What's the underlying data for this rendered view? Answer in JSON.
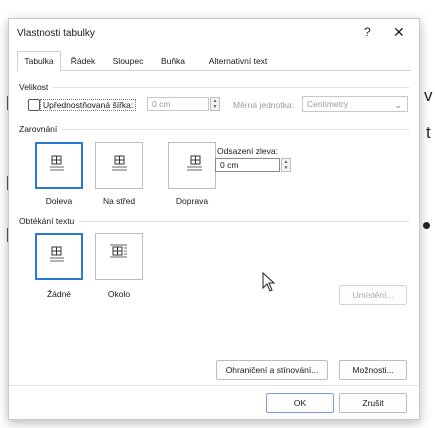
{
  "background": {
    "glyph_v": "v",
    "glyph_t": "t"
  },
  "dialog": {
    "title": "Vlastnosti tabulky",
    "help_label": "?",
    "close_label": "✕"
  },
  "tabs": [
    {
      "label": "Tabulka",
      "active": true
    },
    {
      "label": "Řádek",
      "active": false
    },
    {
      "label": "Sloupec",
      "active": false
    },
    {
      "label": "Buňka",
      "active": false
    },
    {
      "label": "Alternativní text",
      "active": false
    }
  ],
  "size": {
    "section_label": "Velikost",
    "preferred_width_label": "Upřednostňovaná šířka:",
    "preferred_width_checked": false,
    "preferred_width_value": "0 cm",
    "unit_label": "Měrná jednotka:",
    "unit_value": "Centimetry"
  },
  "alignment": {
    "section_label": "Zarovnání",
    "options": [
      {
        "label": "Doleva",
        "selected": true
      },
      {
        "label": "Na střed",
        "selected": false
      },
      {
        "label": "Doprava",
        "selected": false
      }
    ],
    "indent_label": "Odsazení zleva:",
    "indent_value": "0 cm"
  },
  "wrapping": {
    "section_label": "Obtékání textu",
    "options": [
      {
        "label": "Žádné",
        "selected": true
      },
      {
        "label": "Okolo",
        "selected": false
      }
    ],
    "positioning_button": "Umístění..."
  },
  "buttons": {
    "borders": "Ohraničení a stínování...",
    "options": "Možnosti...",
    "ok": "OK",
    "cancel": "Zrušit"
  },
  "colors": {
    "accent": "#2b79d6",
    "dialog_bg": "#ffffff",
    "border": "#bdbdbd"
  }
}
